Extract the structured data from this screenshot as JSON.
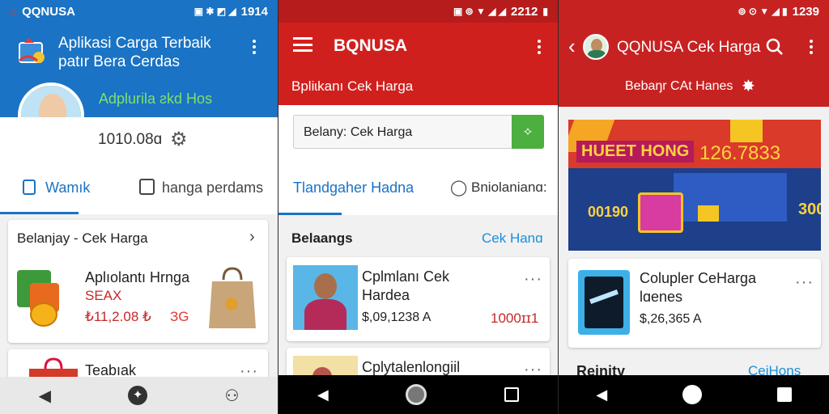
{
  "phone1": {
    "status": {
      "app": "QQNUSA",
      "time": "1914"
    },
    "header": {
      "title_line1": "Aplikasi Carga Terbaik",
      "title_line2": "patır Bera Cerdas",
      "banner_text": "Adplurila ƨkd Hos"
    },
    "profile": {
      "value": "1010.08ɑ"
    },
    "tabs": [
      {
        "label": "Wamık"
      },
      {
        "label": "hanga perdams"
      }
    ],
    "section": {
      "title": "Belanjay - Cek Harga"
    },
    "product1": {
      "title": "Aplıolantı Hrnga",
      "badge": "ЅEAX",
      "price": "₺11,2.08 ₺",
      "price2": "ЗG"
    },
    "product2": {
      "title": "Teabıak"
    },
    "colors": {
      "primary": "#1a73c4",
      "accent": "#d32f2f"
    }
  },
  "phone2": {
    "status": {
      "time": "2212"
    },
    "header": {
      "title": "BQNUSA",
      "subtitle": "Bpliɩkanı Cek Harga"
    },
    "search": {
      "value": "Belany: Cek Harga"
    },
    "tabs": [
      {
        "label": "Tlandgaher Hadna"
      },
      {
        "label": "Bniolanianɑ:"
      }
    ],
    "section": {
      "title": "Belaangs",
      "link": "Cek Hanɑ"
    },
    "product1": {
      "title_line1": "Cplmlanı Cek",
      "title_line2": "Hardea",
      "price": "$,09,1238 A",
      "price2": "1000ɪɪ1"
    },
    "product2": {
      "title": "Cplytalenlongiil"
    },
    "colors": {
      "primary": "#d0201d",
      "search_button": "#4caf3f"
    }
  },
  "phone3": {
    "status": {
      "time": "1239"
    },
    "header": {
      "title": "QQNUSA Cek Harga",
      "subtitle": "Bebaŋr CAt Hanes"
    },
    "banner": {
      "title": "HUEET HONG",
      "value": "126.7833",
      "left_value": "00190",
      "right_value": "300"
    },
    "product1": {
      "title_line1": "Colupler CeHarga",
      "title_line2": "lɑenes",
      "price": "$,26,365 A"
    },
    "section": {
      "title": "Reinity",
      "link": "CeiHons"
    },
    "colors": {
      "primary": "#c72222",
      "banner_bg": "#1e3f8a"
    }
  }
}
